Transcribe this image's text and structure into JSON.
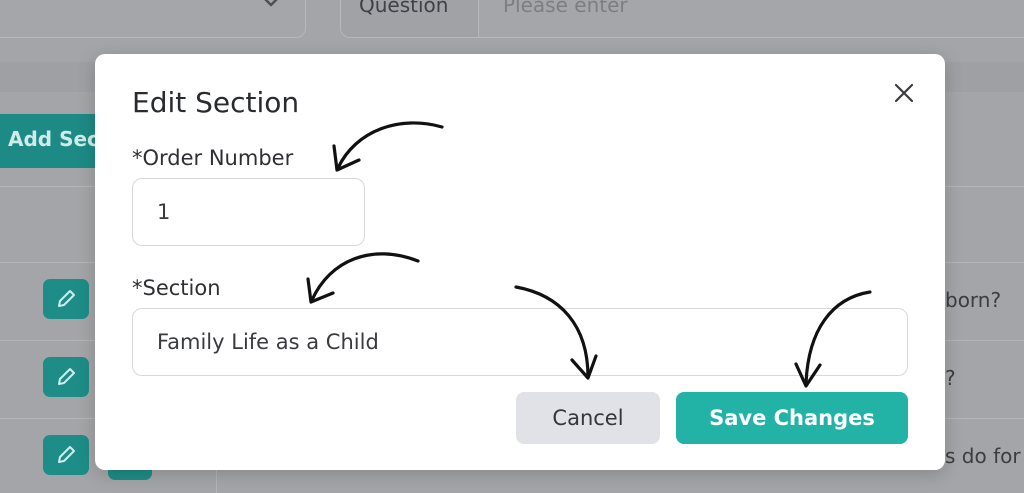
{
  "background": {
    "question_label": "Question",
    "question_placeholder": "Please enter",
    "add_section_label": "Add Section",
    "row_texts": [
      "born?",
      "?",
      "s do for"
    ]
  },
  "modal": {
    "title": "Edit Section",
    "order_number": {
      "label": "*Order Number",
      "value": "1"
    },
    "section": {
      "label": "*Section",
      "value": "Family Life as a Child"
    },
    "cancel_label": "Cancel",
    "save_label": "Save Changes"
  },
  "icons": {
    "close": "close-icon",
    "edit": "pencil-icon",
    "chevron": "chevron-down-icon"
  },
  "colors": {
    "primary": "#22b3a6",
    "cancel_bg": "#e1e2e7",
    "overlay": "#9ea0a3"
  }
}
